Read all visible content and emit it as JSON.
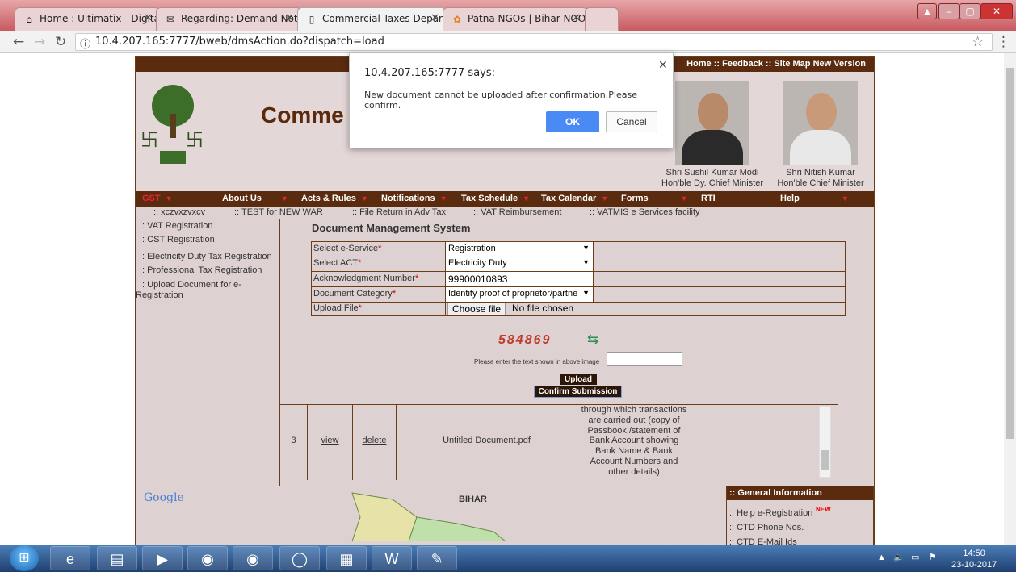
{
  "browser": {
    "tabs": [
      {
        "label": "Home : Ultimatix - Digita",
        "icon": "tcs-icon"
      },
      {
        "label": "Regarding: Demand Not",
        "icon": "mail-icon"
      },
      {
        "label": "Commercial Taxes Depar",
        "icon": "document-icon"
      },
      {
        "label": "Patna NGOs | Bihar NGO",
        "icon": "ngo-icon"
      }
    ],
    "url": "10.4.207.165:7777/bweb/dmsAction.do?dispatch=load"
  },
  "site": {
    "top_links": "Home :: Feedback :: Site Map New Version",
    "title": "Comme",
    "leaders": [
      {
        "name": "Shri Sushil Kumar Modi",
        "role": "Hon'ble Dy. Chief Minister"
      },
      {
        "name": "Shri Nitish Kumar",
        "role": "Hon'ble Chief Minister"
      }
    ],
    "menu": [
      "GST",
      "About Us",
      "Acts & Rules",
      "Notifications",
      "Tax Schedule",
      "Tax Calendar",
      "Forms",
      "RTI",
      "Help"
    ],
    "ticker": [
      ":: xczvxzvxcv",
      ":: TEST for NEW WAR",
      ":: File Return in Adv Tax",
      ":: VAT Reimbursement",
      ":: VATMIS e Services facility"
    ],
    "left_nav": [
      ":: VAT Registration",
      ":: CST Registration",
      ":: Electricity Duty Tax Registration",
      ":: Professional Tax Registration",
      ":: Upload Document for e-",
      "Registration"
    ],
    "dms_title": "Document Management System",
    "form": {
      "service_label": "Select e-Service",
      "service_value": "Registration",
      "act_label": "Select ACT",
      "act_value": "Electricity Duty",
      "ack_label": "Acknowledgment Number",
      "ack_value": "99900010893",
      "cat_label": "Document Category",
      "cat_value": "Identity proof of proprietor/partne",
      "file_label": "Upload File",
      "choose_label": "Choose file",
      "file_status": "No file chosen",
      "required_mark": "*"
    },
    "captcha": "584869",
    "captcha_prompt": "Please enter the text shown in above image",
    "upload_label": "Upload",
    "confirm_label": "Confirm Submission",
    "table_row": {
      "num": "3",
      "view": "view",
      "delete": "delete",
      "file": "Untitled Document.pdf",
      "desc_lines": [
        "through which transactions",
        "are carried out (copy of",
        "Passbook /statement of",
        "Bank Account showing",
        "Bank Name & Bank",
        "Account Numbers and",
        "other details)"
      ]
    },
    "google": "Google",
    "map_label": "BIHAR",
    "gen_info": {
      "title": ":: General Information",
      "items": [
        ":: Help e-Registration",
        ":: CTD Phone Nos.",
        ":: CTD E-Mail Ids"
      ],
      "new_badge": "NEW"
    }
  },
  "dialog": {
    "title": "10.4.207.165:7777 says:",
    "message": "New document cannot be uploaded after confirmation.Please confirm.",
    "ok": "OK",
    "cancel": "Cancel"
  },
  "taskbar": {
    "time": "14:50",
    "date": "23-10-2017"
  },
  "colors": {
    "brand_brown": "#5a2b0f",
    "page_bg": "#ded1d1",
    "ok_blue": "#4a8af4"
  }
}
